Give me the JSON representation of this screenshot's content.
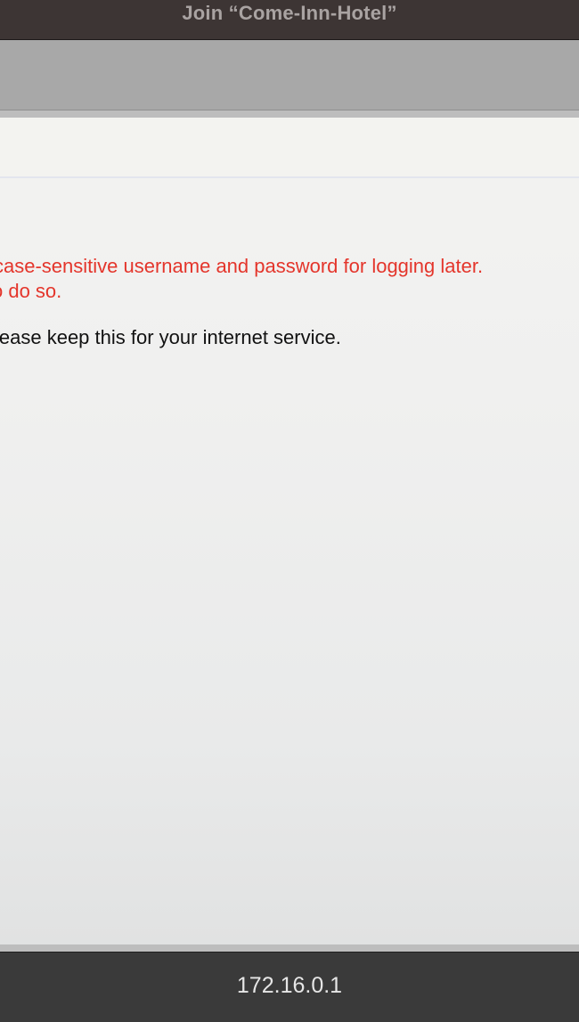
{
  "window": {
    "title": "Join “Come-Inn-Hotel”"
  },
  "page": {
    "warning_line_1": "case-sensitive username and password for logging later.",
    "warning_line_2": "o do so.",
    "info_line": "lease keep this for your internet service."
  },
  "status": {
    "url": "172.16.0.1"
  },
  "colors": {
    "warning": "#e4352b",
    "titlebar": "#3d3534",
    "statusbar": "#3a3a3a"
  }
}
